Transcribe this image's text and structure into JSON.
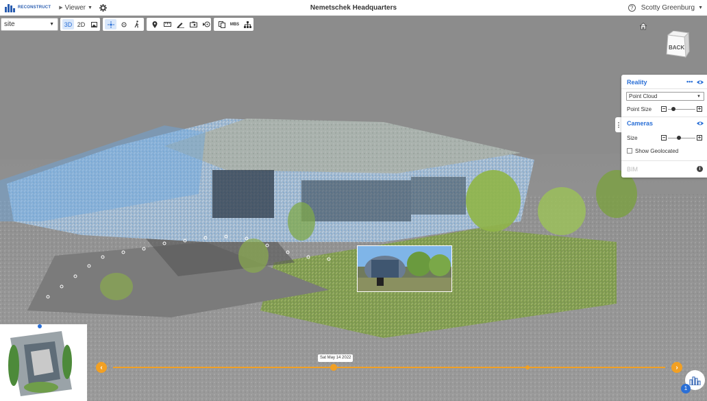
{
  "app": {
    "logo_text": "RECONSTRUCT",
    "viewer_menu_label": "Viewer",
    "project_title": "Nemetschek Headquarters",
    "user_name": "Scotty Greenburg"
  },
  "toolbar": {
    "site_select_value": "site",
    "mode_3d": "3D",
    "mode_2d": "2D",
    "mbs_label": "MBS"
  },
  "view_cube": {
    "face_label": "BACK"
  },
  "layers_panel": {
    "reality_title": "Reality",
    "reality_more": "•••",
    "reality_type_value": "Point Cloud",
    "point_size_label": "Point Size",
    "cameras_title": "Cameras",
    "size_label": "Size",
    "show_geolocated_label": "Show Geolocated",
    "bim_title": "BIM",
    "point_size_level": 0.2,
    "camera_size_level": 0.4
  },
  "timeline": {
    "selected_date": "Sat May 14 2022"
  },
  "badge_count": "1",
  "colors": {
    "accent_blue": "#2a6fd6",
    "timeline_orange": "#f2a023"
  }
}
